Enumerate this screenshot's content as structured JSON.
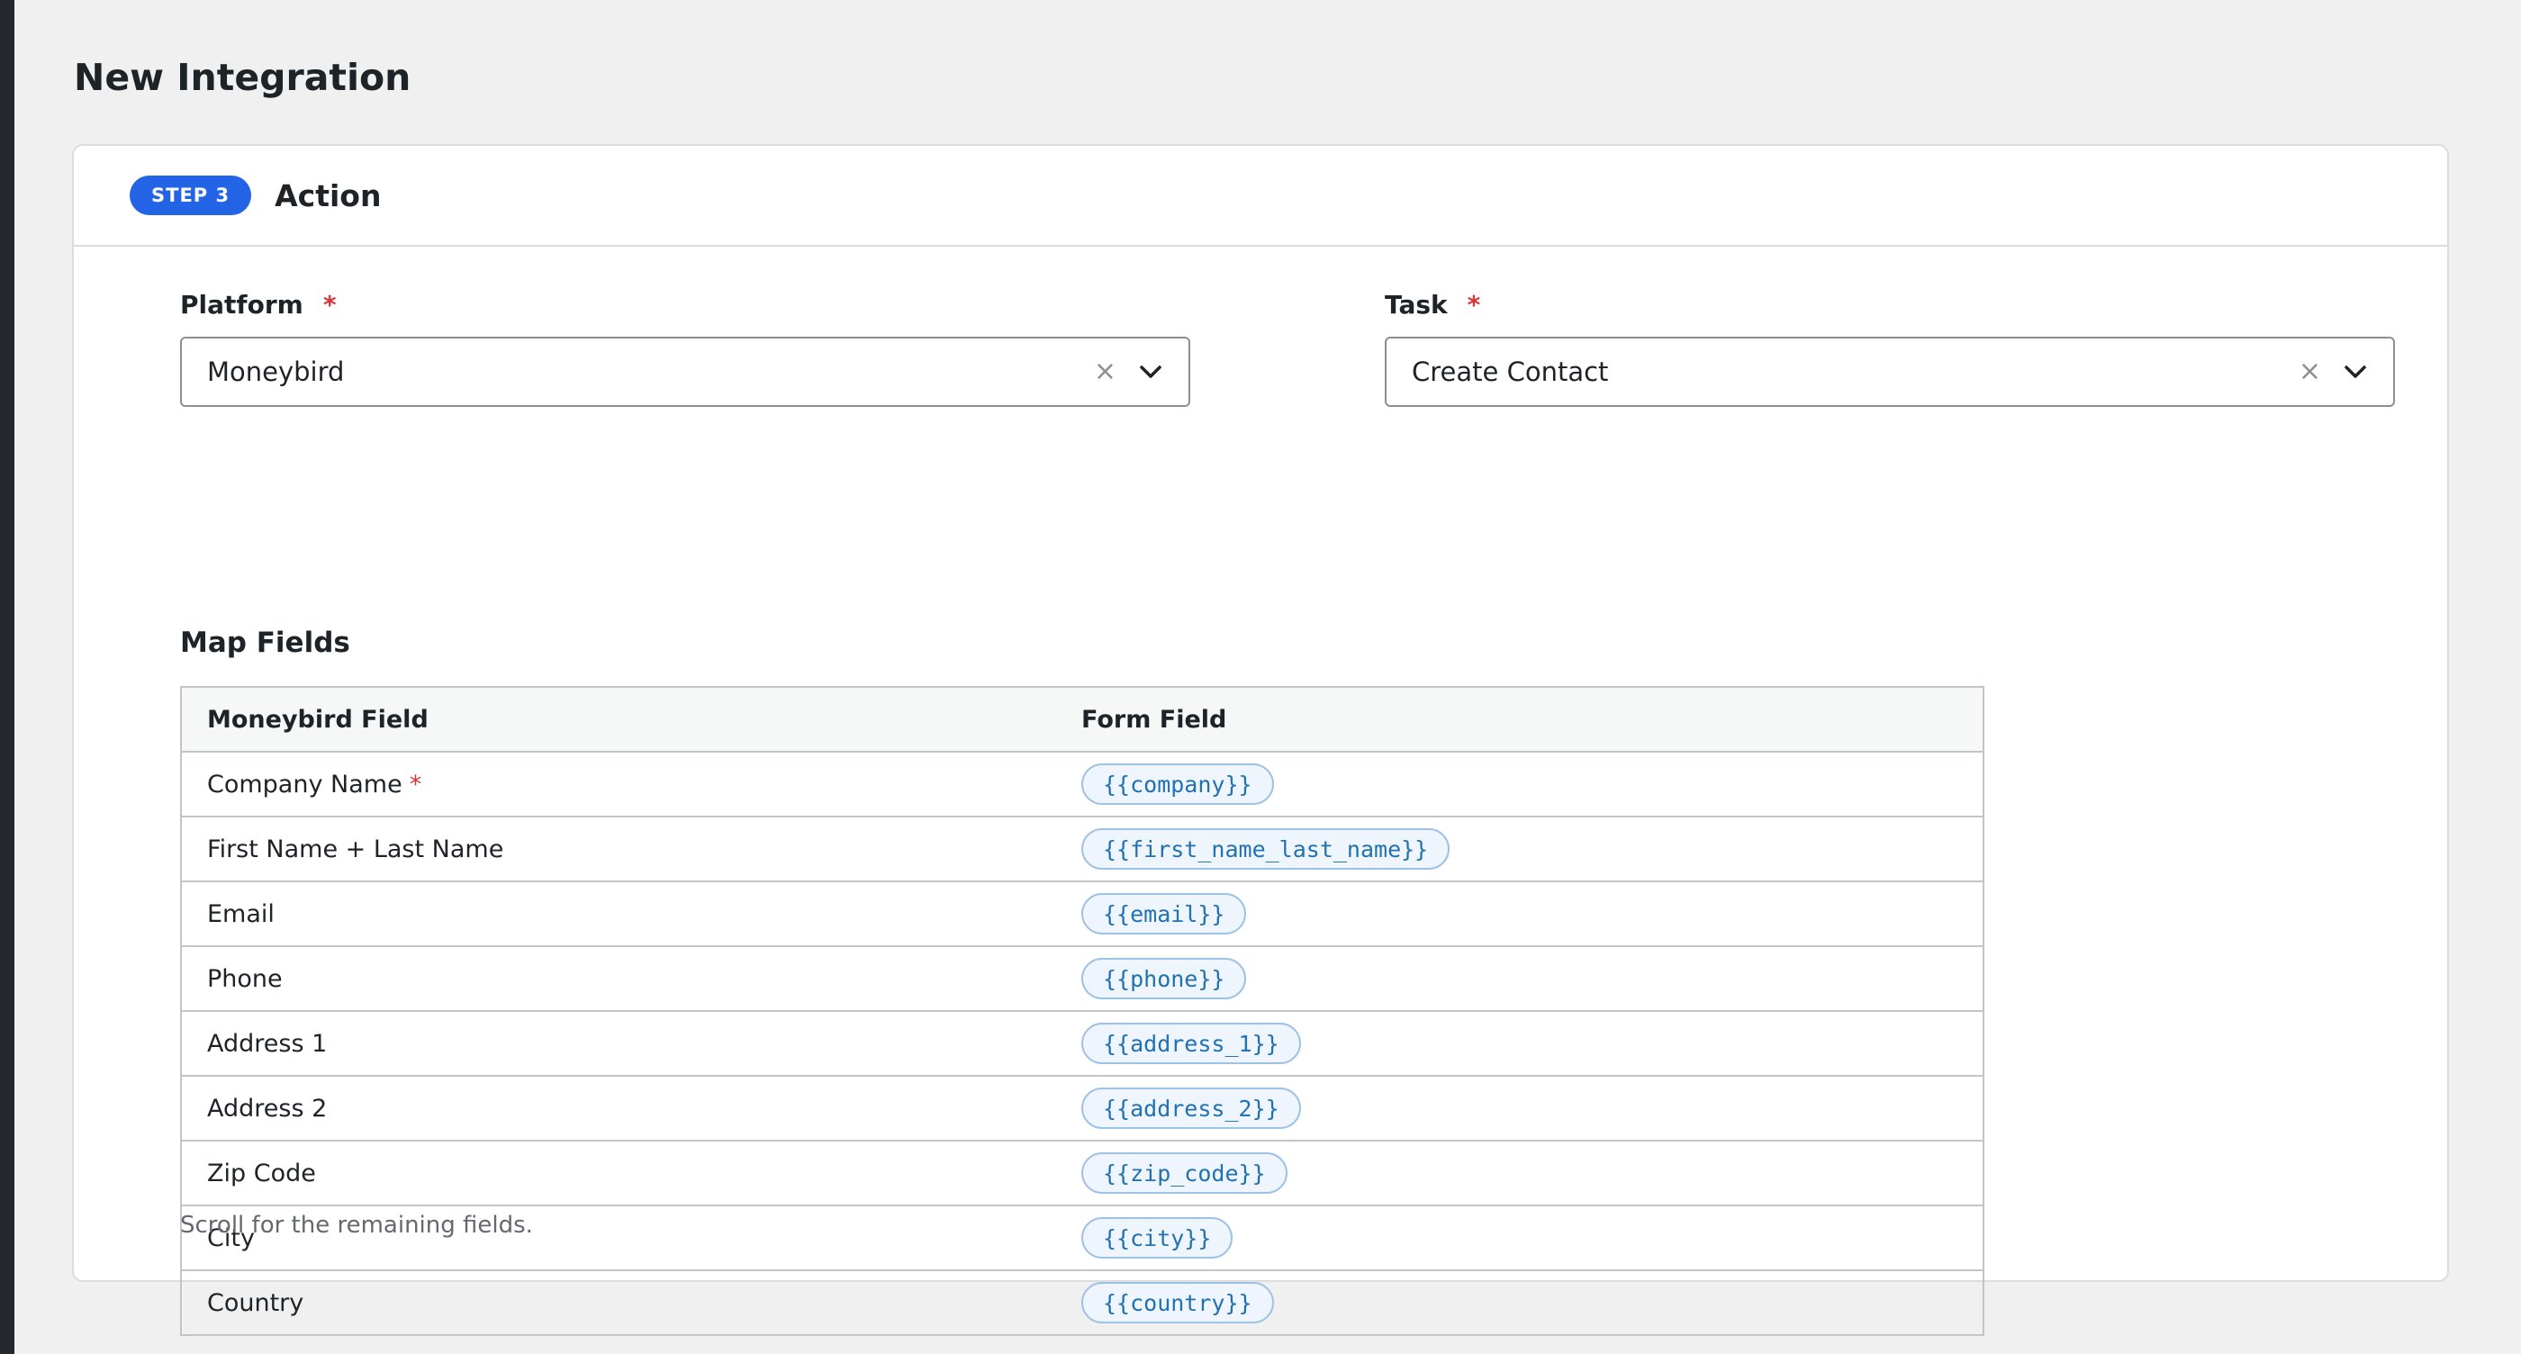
{
  "page": {
    "title": "New Integration"
  },
  "step": {
    "badge": "STEP 3",
    "title": "Action"
  },
  "platform": {
    "label": "Platform",
    "required_mark": "*",
    "value": "Moneybird",
    "clear_symbol": "×"
  },
  "task": {
    "label": "Task",
    "required_mark": "*",
    "value": "Create Contact",
    "clear_symbol": "×"
  },
  "map_fields": {
    "title": "Map Fields",
    "headers": {
      "left": "Moneybird Field",
      "right": "Form Field"
    },
    "rows": [
      {
        "field": "Company Name",
        "required": "*",
        "token": "{{company}}"
      },
      {
        "field": "First Name + Last Name",
        "required": "",
        "token": "{{first_name_last_name}}"
      },
      {
        "field": "Email",
        "required": "",
        "token": "{{email}}"
      },
      {
        "field": "Phone",
        "required": "",
        "token": "{{phone}}"
      },
      {
        "field": "Address 1",
        "required": "",
        "token": "{{address_1}}"
      },
      {
        "field": "Address 2",
        "required": "",
        "token": "{{address_2}}"
      },
      {
        "field": "Zip Code",
        "required": "",
        "token": "{{zip_code}}"
      },
      {
        "field": "City",
        "required": "",
        "token": "{{city}}"
      },
      {
        "field": "Country",
        "required": "",
        "token": "{{country}}"
      }
    ],
    "helper": "Scroll for the remaining fields."
  },
  "colors": {
    "accent": "#2264e5",
    "required": "#d63638",
    "token_text": "#2271b1",
    "token_bg": "#eef5fc"
  },
  "icons": {
    "clear": "close-icon",
    "dropdown": "chevron-down-icon"
  }
}
